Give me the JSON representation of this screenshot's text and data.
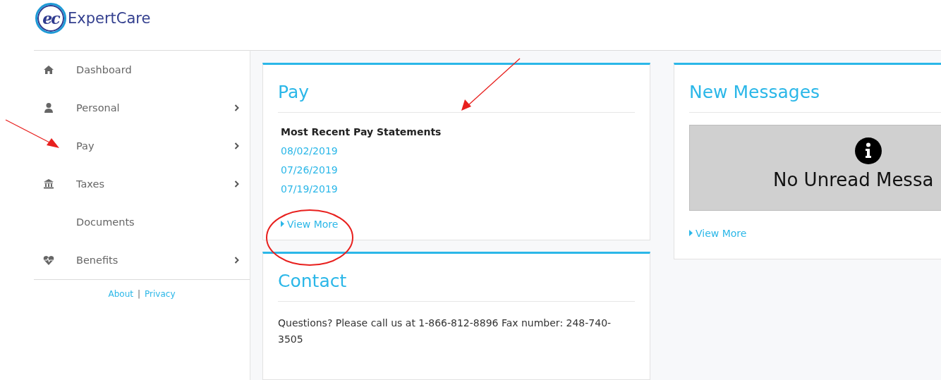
{
  "logo": {
    "mark": "ec",
    "name": "ExpertCare"
  },
  "sidebar": {
    "items": [
      {
        "label": "Dashboard",
        "kind": "home",
        "has_submenu": false
      },
      {
        "label": "Personal",
        "kind": "person",
        "has_submenu": true
      },
      {
        "label": "Pay",
        "kind": "plain",
        "has_submenu": true
      },
      {
        "label": "Taxes",
        "kind": "bank",
        "has_submenu": true
      },
      {
        "label": "Documents",
        "kind": "plain",
        "has_submenu": false
      },
      {
        "label": "Benefits",
        "kind": "heart",
        "has_submenu": true
      }
    ],
    "footer_links": [
      "About",
      "Privacy"
    ],
    "footer_separator": "|"
  },
  "pay_card": {
    "title": "Pay",
    "subtitle": "Most Recent Pay Statements",
    "statements": [
      "08/02/2019",
      "07/26/2019",
      "07/19/2019"
    ],
    "view_more": "View More"
  },
  "messages_card": {
    "title": "New Messages",
    "notice": "No Unread Messa",
    "view_more": "View More"
  },
  "contact_card": {
    "title": "Contact",
    "text": "Questions? Please call us at 1-866-812-8896 Fax number: 248-740-3505"
  }
}
